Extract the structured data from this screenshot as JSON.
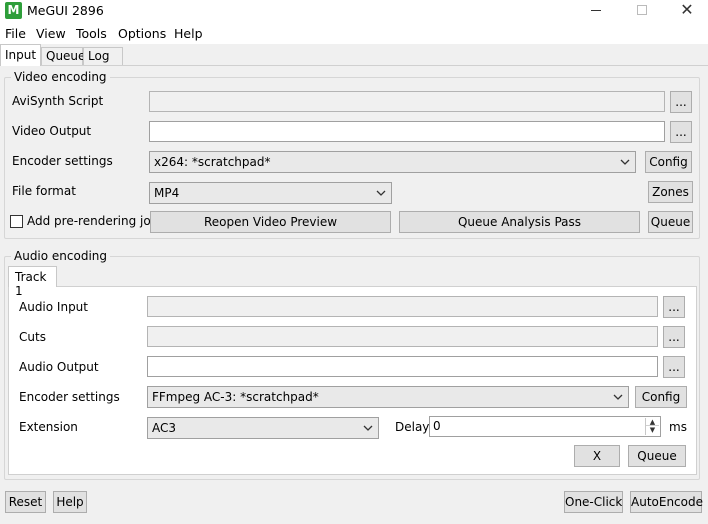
{
  "window": {
    "title": "MeGUI 2896",
    "icon_name": "megui-logo-icon",
    "icon_letter": "M",
    "minimize_icon": "minimize-icon",
    "maximize_icon": "maximize-icon",
    "close_glyph": "✕"
  },
  "menu": [
    "File",
    "View",
    "Tools",
    "Options",
    "Help"
  ],
  "tabs": [
    "Input",
    "Queue",
    "Log"
  ],
  "video": {
    "group_title": "Video encoding",
    "avisynth_label": "AviSynth Script",
    "avisynth_value": "",
    "output_label": "Video Output",
    "output_value": "",
    "encoder_label": "Encoder settings",
    "encoder_value": "x264: *scratchpad*",
    "config_label": "Config",
    "format_label": "File format",
    "format_value": "MP4",
    "zones_label": "Zones",
    "prerender_label": "Add pre-rendering job",
    "reopen_label": "Reopen Video Preview",
    "analysis_label": "Queue Analysis Pass",
    "queue_label": "Queue",
    "browse_label": "..."
  },
  "audio": {
    "group_title": "Audio encoding",
    "track_tab": "Track 1",
    "input_label": "Audio Input",
    "input_value": "",
    "cuts_label": "Cuts",
    "cuts_value": "",
    "output_label": "Audio Output",
    "output_value": "",
    "encoder_label": "Encoder settings",
    "encoder_value": "FFmpeg AC-3: *scratchpad*",
    "config_label": "Config",
    "extension_label": "Extension",
    "extension_value": "AC3",
    "delay_label": "Delay",
    "delay_value": "0",
    "delay_unit": "ms",
    "remove_label": "X",
    "queue_label": "Queue",
    "browse_label": "..."
  },
  "footer": {
    "reset_label": "Reset",
    "help_label": "Help",
    "oneclick_label": "One-Click",
    "autoencode_label": "AutoEncode"
  }
}
